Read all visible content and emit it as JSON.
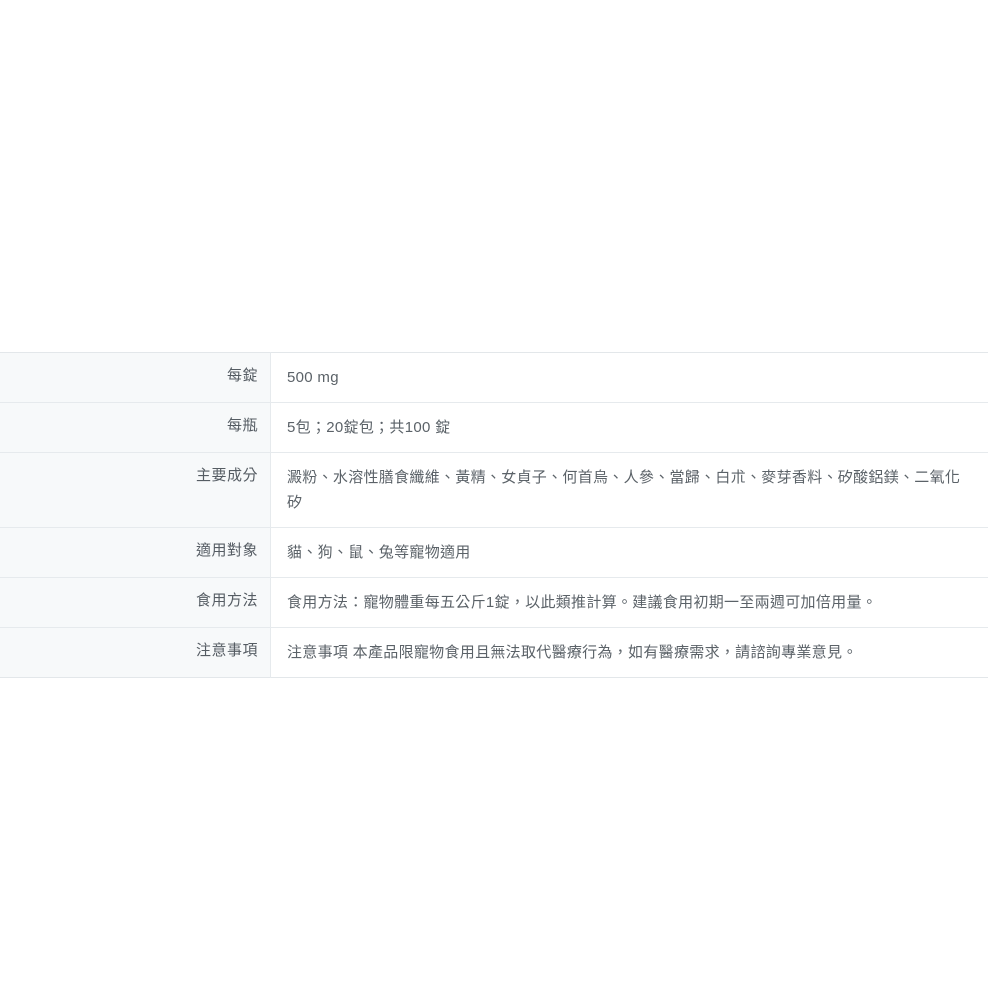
{
  "page": {
    "background_color": "#ffffff",
    "label_column_background": "#f7f9fa",
    "value_column_background": "#ffffff",
    "border_color": "#e6eaed",
    "label_text_color": "#555c63",
    "value_text_color": "#5b6268"
  },
  "spec_table": {
    "rows": [
      {
        "key": "per-tablet",
        "label": "每錠",
        "value": "500 mg"
      },
      {
        "key": "per-bottle",
        "label": "每瓶",
        "value": "5包；20錠包；共100 錠"
      },
      {
        "key": "ingredients",
        "label": "主要成分",
        "value": "澱粉、水溶性膳食纖維、黃精、女貞子、何首烏、人參、當歸、白朮、麥芽香料、矽酸鋁鎂、二氧化矽"
      },
      {
        "key": "suitable-for",
        "label": "適用對象",
        "value": "貓、狗、鼠、兔等寵物適用"
      },
      {
        "key": "usage",
        "label": "食用方法",
        "value": "食用方法：寵物體重每五公斤1錠，以此類推計算。建議食用初期一至兩週可加倍用量。"
      },
      {
        "key": "notes",
        "label": "注意事項",
        "value": "注意事項 本產品限寵物食用且無法取代醫療行為，如有醫療需求，請諮詢專業意見。"
      }
    ]
  }
}
